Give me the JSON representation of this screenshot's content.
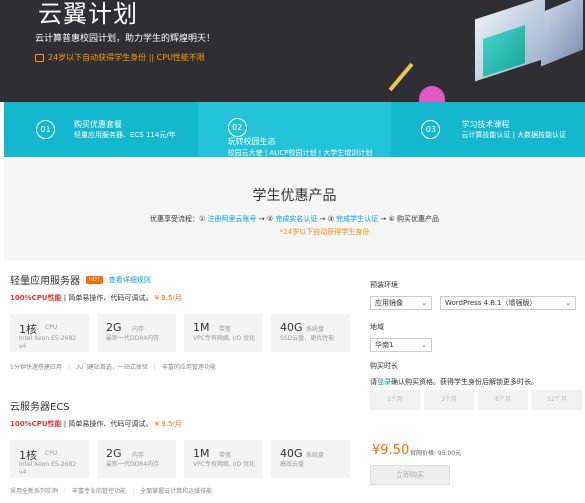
{
  "hero": {
    "title": "云翼计划",
    "subtitle": "云计算普惠校园计划，助力学生的辉煌明天！",
    "note": "24岁以下自动获得学生身份 || CPU性能不限"
  },
  "steps": [
    {
      "num": "01",
      "title": "购买优惠套餐",
      "desc": "轻量应用服务器、ECS 114元/年"
    },
    {
      "num": "02",
      "title": "玩转校园生态",
      "desc": "校园云大使 | AUCP校园计划 | 大学生增训计划"
    },
    {
      "num": "03",
      "title": "学习技术课程",
      "desc": "云计算技能认证 | 大数据技能认证"
    }
  ],
  "promo": {
    "title": "学生优惠产品",
    "flow_prefix": "优惠享受流程：① ",
    "flow_step1": "注册阿里云账号",
    "flow_arrow1": " → ② ",
    "flow_step2": "完成实名认证",
    "flow_arrow2": " → ③ ",
    "flow_step3": "完成学生认证",
    "flow_tail": " → ④ 购买优惠产品",
    "note": "*24岁以下自动获得学生身份"
  },
  "products": [
    {
      "name": "轻量应用服务器",
      "badge": "HOT",
      "detail_link": "查看详细规则",
      "hot": "100%CPU性能",
      "tag": " | 简单易操作、代码可调试。",
      "price": "¥ 9.5/月",
      "specs": [
        {
          "big": "1核",
          "unit": "CPU",
          "sub": "Intel Xeon E5-2682 v4"
        },
        {
          "big": "2G",
          "unit": "内存",
          "sub": "最新一代DDR4内存"
        },
        {
          "big": "1M",
          "unit": "带宽",
          "sub": "VPC专有网络, I/O 优化"
        },
        {
          "big": "40G",
          "unit": "系统盘",
          "sub": "SSD云盘，更优性能"
        }
      ],
      "features": [
        "1分钟快速搭建应用",
        "入门建站首选，一站式体验",
        "丰富的应用管理功能"
      ]
    },
    {
      "name": "云服务器ECS",
      "hot": "100%CPU性能",
      "tag": " | 简单易操作、代码可调试。",
      "price": "¥ 9.5/月",
      "specs": [
        {
          "big": "1核",
          "unit": "CPU",
          "sub": "Intel Xeon E5-2682 v4"
        },
        {
          "big": "2G",
          "unit": "内存",
          "sub": "最新一代DDR4内存"
        },
        {
          "big": "1M",
          "unit": "带宽",
          "sub": "VPC专有网络, I/O 优化"
        },
        {
          "big": "40G",
          "unit": "系统盘",
          "sub": "高效云盘"
        }
      ],
      "features": [
        "采用全新系列实例",
        "丰富专业的管控功能",
        "全面掌握云计算和运维技能"
      ]
    }
  ],
  "panel": {
    "env_label": "预装环境",
    "env_value": "应用镜像",
    "image_value": "WordPress 4.8.1（增强版）",
    "region_label": "地域",
    "region_value": "华南1",
    "duration_label": "购买时长",
    "warn_prefix": "请",
    "warn_login": "登录",
    "warn_suffix": "确认购买资格。获得学生身份后解锁更多时长。",
    "durations": [
      "1个月",
      "3个月",
      "6个月",
      "12个月"
    ],
    "price": "¥9.50",
    "orig_price": "官网价格: 95.00元",
    "buy_label": "立即购买"
  }
}
